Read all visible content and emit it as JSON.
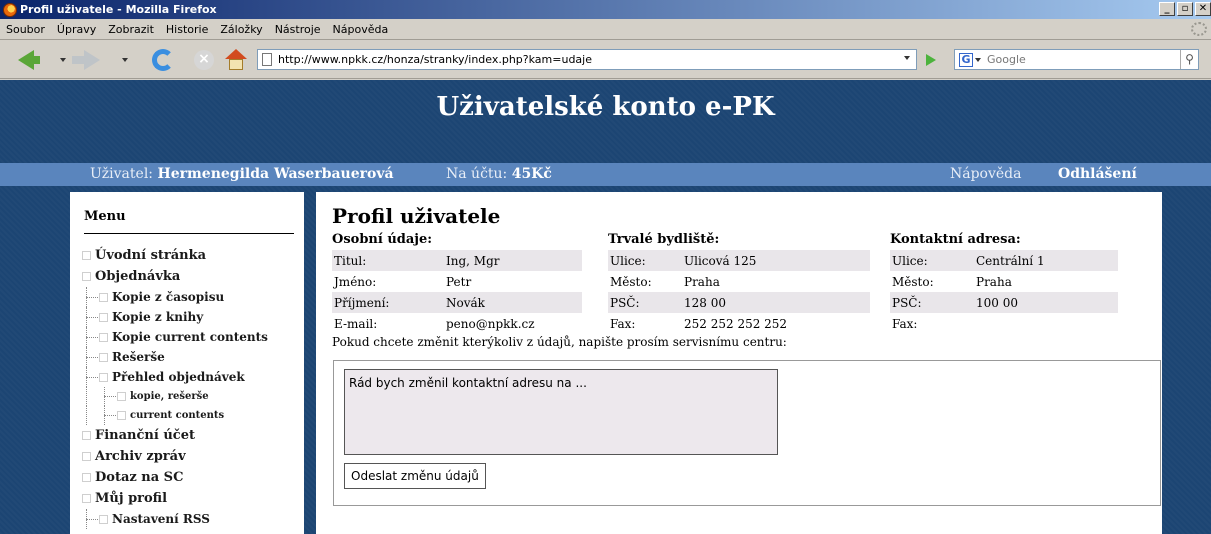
{
  "window": {
    "title": "Profil uživatele - Mozilla Firefox"
  },
  "menubar": [
    "Soubor",
    "Úpravy",
    "Zobrazit",
    "Historie",
    "Záložky",
    "Nástroje",
    "Nápověda"
  ],
  "browser": {
    "url": "http://www.npkk.cz/honza/stranky/index.php?kam=udaje",
    "search_placeholder": "Google"
  },
  "site": {
    "title": "Uživatelské konto e-PK",
    "user_label": "Uživatel:",
    "user_name": "Hermenegilda Waserbauerová",
    "account_label": "Na účtu:",
    "account_value": "45Kč",
    "help": "Nápověda",
    "logout": "Odhlášení"
  },
  "menu": {
    "heading": "Menu",
    "items": [
      {
        "label": "Úvodní stránka",
        "level": 1
      },
      {
        "label": "Objednávka",
        "level": 1
      },
      {
        "label": "Kopie z časopisu",
        "level": 2
      },
      {
        "label": "Kopie z knihy",
        "level": 2
      },
      {
        "label": "Kopie current contents",
        "level": 2
      },
      {
        "label": "Rešerše",
        "level": 2
      },
      {
        "label": "Přehled objednávek",
        "level": 2
      },
      {
        "label": "kopie, rešerše",
        "level": 3
      },
      {
        "label": "current contents",
        "level": 3
      },
      {
        "label": "Finanční účet",
        "level": 1
      },
      {
        "label": "Archiv zpráv",
        "level": 1
      },
      {
        "label": "Dotaz na SC",
        "level": 1
      },
      {
        "label": "Můj profil",
        "level": 1
      },
      {
        "label": "Nastavení RSS",
        "level": 2
      }
    ]
  },
  "profile": {
    "title": "Profil uživatele",
    "personal": {
      "heading": "Osobní údaje:",
      "rows": [
        {
          "label": "Titul:",
          "value": "Ing, Mgr"
        },
        {
          "label": "Jméno:",
          "value": "Petr"
        },
        {
          "label": "Příjmení:",
          "value": "Novák"
        },
        {
          "label": "E-mail:",
          "value": "peno@npkk.cz"
        }
      ]
    },
    "permanent": {
      "heading": "Trvalé bydliště:",
      "rows": [
        {
          "label": "Ulice:",
          "value": "Ulicová 125"
        },
        {
          "label": "Město:",
          "value": "Praha"
        },
        {
          "label": "PSČ:",
          "value": "128 00"
        },
        {
          "label": "Fax:",
          "value": "252 252 252 252"
        }
      ]
    },
    "contact": {
      "heading": "Kontaktní adresa:",
      "rows": [
        {
          "label": "Ulice:",
          "value": "Centrální 1"
        },
        {
          "label": "Město:",
          "value": "Praha"
        },
        {
          "label": "PSČ:",
          "value": "100 00"
        },
        {
          "label": "Fax:",
          "value": ""
        }
      ]
    },
    "note": "Pokud chcete změnit kterýkoliv z údajů, napište prosím servisnímu centru:",
    "message": "Rád bych změnil kontaktní adresu na ...",
    "send_button": "Odeslat změnu údajů"
  }
}
